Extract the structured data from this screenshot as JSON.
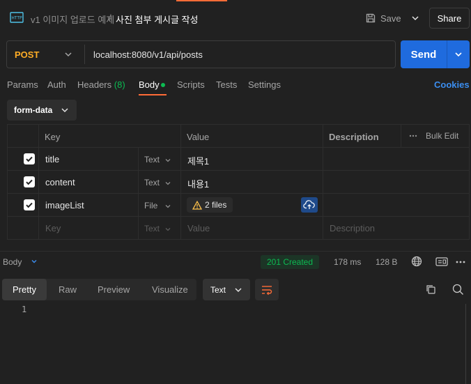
{
  "header": {
    "breadcrumb_parent": "v1 이미지 업로드 예제",
    "breadcrumb_sep": "/",
    "title": "사진 첨부 게시글 작성",
    "save_label": "Save",
    "share_label": "Share"
  },
  "request": {
    "method": "POST",
    "url": "localhost:8080/v1/api/posts",
    "send_label": "Send"
  },
  "tabs": {
    "params": "Params",
    "auth": "Auth",
    "headers": "Headers",
    "headers_count": "(8)",
    "body": "Body",
    "scripts": "Scripts",
    "tests": "Tests",
    "settings": "Settings",
    "cookies": "Cookies"
  },
  "body_type": "form-data",
  "table": {
    "columns": {
      "key": "Key",
      "value": "Value",
      "description": "Description",
      "bulk_edit": "Bulk Edit"
    },
    "rows": [
      {
        "key": "title",
        "type": "Text",
        "value": "제목1"
      },
      {
        "key": "content",
        "type": "Text",
        "value": "내용1"
      },
      {
        "key": "imageList",
        "type": "File",
        "value": "2 files"
      }
    ],
    "placeholder": {
      "key": "Key",
      "type": "Text",
      "value": "Value",
      "description": "Description"
    }
  },
  "response": {
    "label": "Body",
    "status": "201 Created",
    "time": "178 ms",
    "size": "128 B",
    "tabs": {
      "pretty": "Pretty",
      "raw": "Raw",
      "preview": "Preview",
      "visualize": "Visualize"
    },
    "format": "Text",
    "line_number": "1"
  },
  "colors": {
    "accent_orange": "#ff6c37",
    "send_blue": "#1f6bde",
    "method_post": "#ffad26",
    "success_green": "#0cbb52",
    "link_blue": "#3b8ef0"
  },
  "icons": [
    "http-icon",
    "save-icon",
    "chevron-down-icon",
    "warning-icon",
    "upload-cloud-icon",
    "globe-icon",
    "save-response-icon",
    "more-icon",
    "wrap-lines-icon",
    "copy-icon",
    "search-icon",
    "check-icon"
  ]
}
